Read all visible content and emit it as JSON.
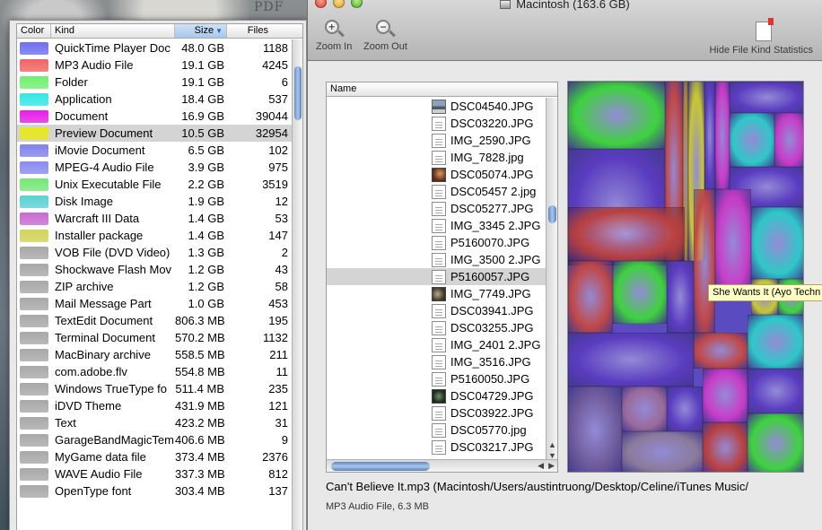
{
  "desktop": {
    "fragment_text": "PDF"
  },
  "kind_panel": {
    "columns": {
      "color": "Color",
      "kind": "Kind",
      "size": "Size",
      "files": "Files"
    },
    "rows": [
      {
        "color": "#6f6ff2",
        "kind": "QuickTime Player Doc",
        "size": "48.0 GB",
        "files": "1188"
      },
      {
        "color": "#f06464",
        "kind": "MP3 Audio File",
        "size": "19.1 GB",
        "files": "4245"
      },
      {
        "color": "#6ef06e",
        "kind": "Folder",
        "size": "19.1 GB",
        "files": "6"
      },
      {
        "color": "#33e6e6",
        "kind": "Application",
        "size": "18.4 GB",
        "files": "537"
      },
      {
        "color": "#e61ee6",
        "kind": "Document",
        "size": "16.9 GB",
        "files": "39044"
      },
      {
        "color": "#e8e81e",
        "kind": "Preview Document",
        "size": "10.5 GB",
        "files": "32954"
      },
      {
        "color": "#8282ea",
        "kind": "iMovie Document",
        "size": "6.5 GB",
        "files": "102"
      },
      {
        "color": "#8a8af0",
        "kind": "MPEG-4 Audio File",
        "size": "3.9 GB",
        "files": "975"
      },
      {
        "color": "#74e874",
        "kind": "Unix Executable File",
        "size": "2.2 GB",
        "files": "3519"
      },
      {
        "color": "#5ad2d2",
        "kind": "Disk Image",
        "size": "1.9 GB",
        "files": "12"
      },
      {
        "color": "#c86ad2",
        "kind": "Warcraft III Data",
        "size": "1.4 GB",
        "files": "53"
      },
      {
        "color": "#d2d25a",
        "kind": "Installer package",
        "size": "1.4 GB",
        "files": "147"
      },
      {
        "color": "#a8a8a8",
        "kind": "VOB File (DVD Video)",
        "size": "1.3 GB",
        "files": "2"
      },
      {
        "color": "#a8a8a8",
        "kind": "Shockwave Flash Mov",
        "size": "1.2 GB",
        "files": "43"
      },
      {
        "color": "#a8a8a8",
        "kind": "ZIP archive",
        "size": "1.2 GB",
        "files": "58"
      },
      {
        "color": "#a8a8a8",
        "kind": "Mail Message Part",
        "size": "1.0 GB",
        "files": "453"
      },
      {
        "color": "#a8a8a8",
        "kind": "TextEdit Document",
        "size": "806.3 MB",
        "files": "195"
      },
      {
        "color": "#a8a8a8",
        "kind": "Terminal Document",
        "size": "570.2 MB",
        "files": "1132"
      },
      {
        "color": "#a8a8a8",
        "kind": "MacBinary archive",
        "size": "558.5 MB",
        "files": "211"
      },
      {
        "color": "#a8a8a8",
        "kind": "com.adobe.flv",
        "size": "554.8 MB",
        "files": "11"
      },
      {
        "color": "#a8a8a8",
        "kind": "Windows TrueType fo",
        "size": "511.4 MB",
        "files": "235"
      },
      {
        "color": "#a8a8a8",
        "kind": "iDVD Theme",
        "size": "431.9 MB",
        "files": "121"
      },
      {
        "color": "#a8a8a8",
        "kind": "Text",
        "size": "423.2 MB",
        "files": "31"
      },
      {
        "color": "#a8a8a8",
        "kind": "GarageBandMagicTem",
        "size": "406.6 MB",
        "files": "9"
      },
      {
        "color": "#a8a8a8",
        "kind": "MyGame data file",
        "size": "373.4 MB",
        "files": "2376"
      },
      {
        "color": "#a8a8a8",
        "kind": "WAVE Audio File",
        "size": "337.3 MB",
        "files": "812"
      },
      {
        "color": "#a8a8a8",
        "kind": "OpenType font",
        "size": "303.4 MB",
        "files": "137"
      }
    ]
  },
  "window": {
    "title": "Macintosh (163.6 GB)",
    "toolbar": {
      "zoom_in": "Zoom In",
      "zoom_out": "Zoom Out",
      "hide_stats": "Hide File Kind Statistics"
    },
    "file_browser": {
      "header": "Name",
      "files": [
        {
          "name": "DSC04540.JPG",
          "icon": "photo-a"
        },
        {
          "name": "DSC03220.JPG",
          "icon": "doc"
        },
        {
          "name": "IMG_2590.JPG",
          "icon": "doc"
        },
        {
          "name": "IMG_7828.jpg",
          "icon": "doc"
        },
        {
          "name": "DSC05074.JPG",
          "icon": "photo-b"
        },
        {
          "name": "DSC05457 2.jpg",
          "icon": "doc"
        },
        {
          "name": "DSC05277.JPG",
          "icon": "doc"
        },
        {
          "name": "IMG_3345 2.JPG",
          "icon": "doc"
        },
        {
          "name": "P5160070.JPG",
          "icon": "doc"
        },
        {
          "name": "IMG_3500 2.JPG",
          "icon": "doc"
        },
        {
          "name": "P5160057.JPG",
          "icon": "doc"
        },
        {
          "name": "IMG_7749.JPG",
          "icon": "photo-c"
        },
        {
          "name": "DSC03941.JPG",
          "icon": "doc"
        },
        {
          "name": "DSC03255.JPG",
          "icon": "doc"
        },
        {
          "name": "IMG_2401 2.JPG",
          "icon": "doc"
        },
        {
          "name": "IMG_3516.JPG",
          "icon": "doc"
        },
        {
          "name": "P5160050.JPG",
          "icon": "doc"
        },
        {
          "name": "DSC04729.JPG",
          "icon": "photo-d"
        },
        {
          "name": "DSC03922.JPG",
          "icon": "doc"
        },
        {
          "name": "DSC05770.jpg",
          "icon": "doc"
        },
        {
          "name": "DSC03217.JPG",
          "icon": "doc"
        }
      ]
    },
    "treemap_tooltip": "She Wants It (Ayo Techn",
    "selected_path": "Can't Believe It.mp3 (Macintosh/Users/austintruong/Desktop/Celine/iTunes Music/",
    "selected_info": "MP3 Audio File, 6.3 MB"
  }
}
